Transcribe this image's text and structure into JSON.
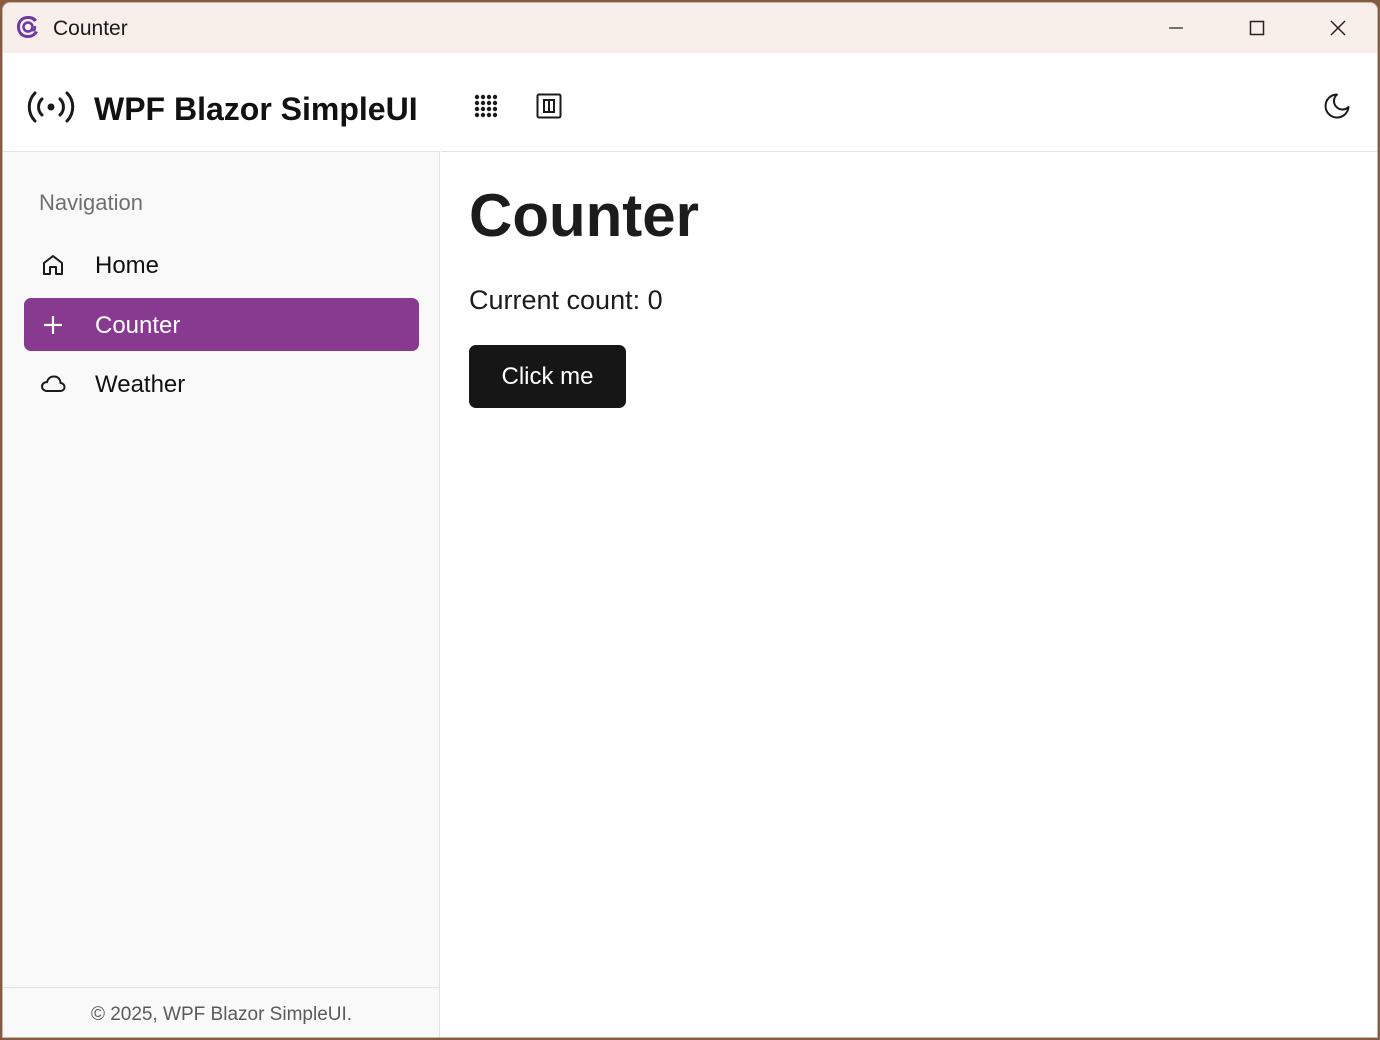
{
  "window": {
    "title": "Counter",
    "icons": {
      "app": "blazor-logo-icon",
      "minimize": "minimize-icon",
      "maximize": "maximize-icon",
      "close": "close-icon"
    }
  },
  "sidebar": {
    "brand_title": "WPF Blazor SimpleUI",
    "brand_icon": "broadcast-icon",
    "nav_heading": "Navigation",
    "items": [
      {
        "label": "Home",
        "icon": "home-icon",
        "active": false
      },
      {
        "label": "Counter",
        "icon": "plus-icon",
        "active": true
      },
      {
        "label": "Weather",
        "icon": "cloud-icon",
        "active": false
      }
    ],
    "footer": "© 2025, WPF Blazor SimpleUI."
  },
  "topbar": {
    "icons": [
      "apps-grid-icon",
      "panel-toggle-icon",
      "moon-icon"
    ]
  },
  "main": {
    "title": "Counter",
    "count_text": "Current count: 0",
    "button_label": "Click me"
  },
  "colors": {
    "accent": "#873a8f",
    "button_bg": "#161616",
    "titlebar_bg": "#f8eeea",
    "sidebar_bg": "#f9f9f9"
  }
}
